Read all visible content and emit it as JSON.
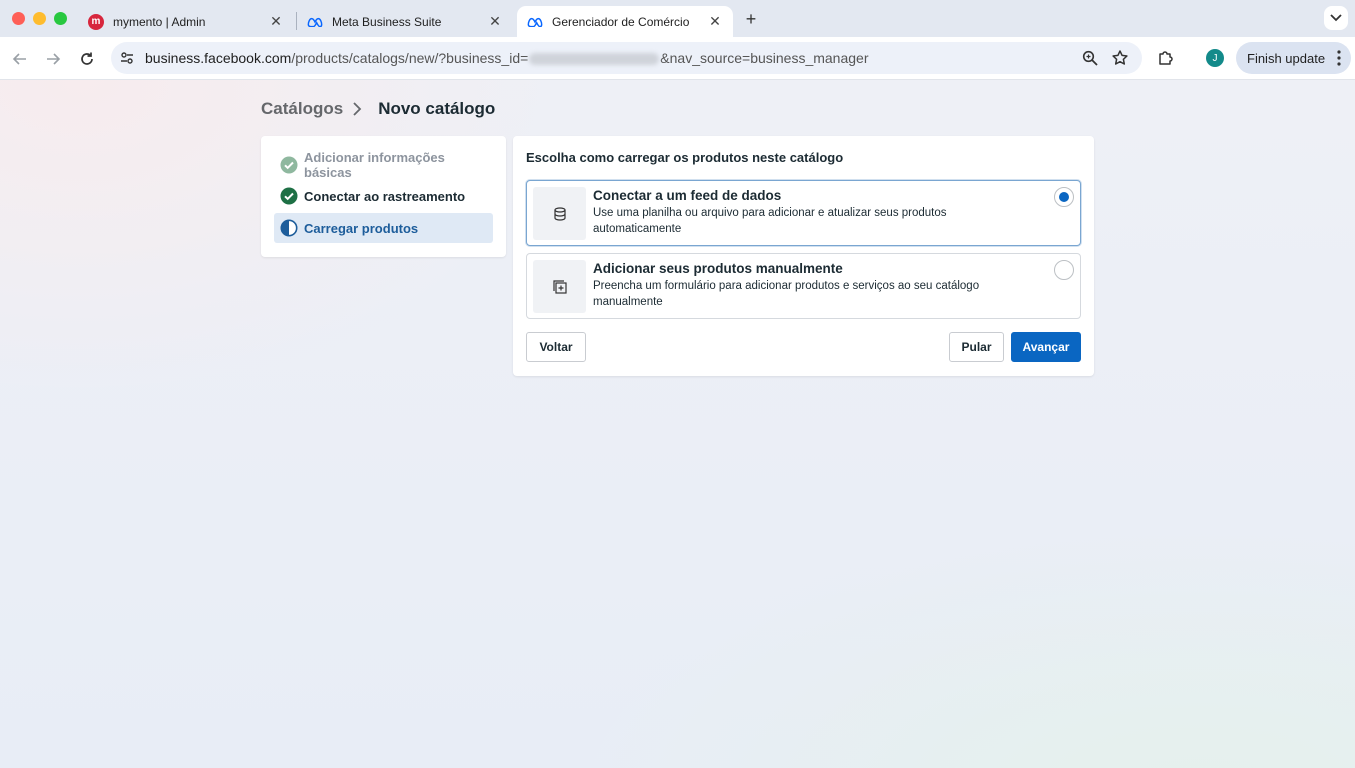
{
  "browser": {
    "tabs": [
      {
        "title": "mymento | Admin",
        "icon": "mymento-favicon",
        "active": false
      },
      {
        "title": "Meta Business Suite",
        "icon": "meta-favicon",
        "active": false
      },
      {
        "title": "Gerenciador de Comércio",
        "icon": "meta-favicon",
        "active": true
      }
    ],
    "url": {
      "host": "business.facebook.com",
      "path_prefix": "/products/catalogs/new/?business_id=",
      "path_suffix": "&nav_source=business_manager"
    },
    "profile_initial": "J",
    "finish_update_label": "Finish update"
  },
  "page": {
    "breadcrumb": {
      "parent": "Catálogos",
      "current": "Novo catálogo"
    },
    "steps": [
      {
        "label": "Adicionar informações básicas",
        "state": "done-muted"
      },
      {
        "label": "Conectar ao rastreamento",
        "state": "done"
      },
      {
        "label": "Carregar produtos",
        "state": "current"
      }
    ],
    "heading": "Escolha como carregar os produtos neste catálogo",
    "options": [
      {
        "title": "Conectar a um feed de dados",
        "description": "Use uma planilha ou arquivo para adicionar e atualizar seus produtos automaticamente",
        "icon": "database-icon",
        "selected": true
      },
      {
        "title": "Adicionar seus produtos manualmente",
        "description": "Preencha um formulário para adicionar produtos e serviços ao seu catálogo manualmente",
        "icon": "add-item-icon",
        "selected": false
      }
    ],
    "buttons": {
      "back": "Voltar",
      "skip": "Pular",
      "next": "Avançar"
    }
  },
  "colors": {
    "primary": "#0a66c2",
    "done_green": "#1e7045",
    "muted_green": "#8fb89f",
    "current_bg": "#dfe9f5"
  }
}
